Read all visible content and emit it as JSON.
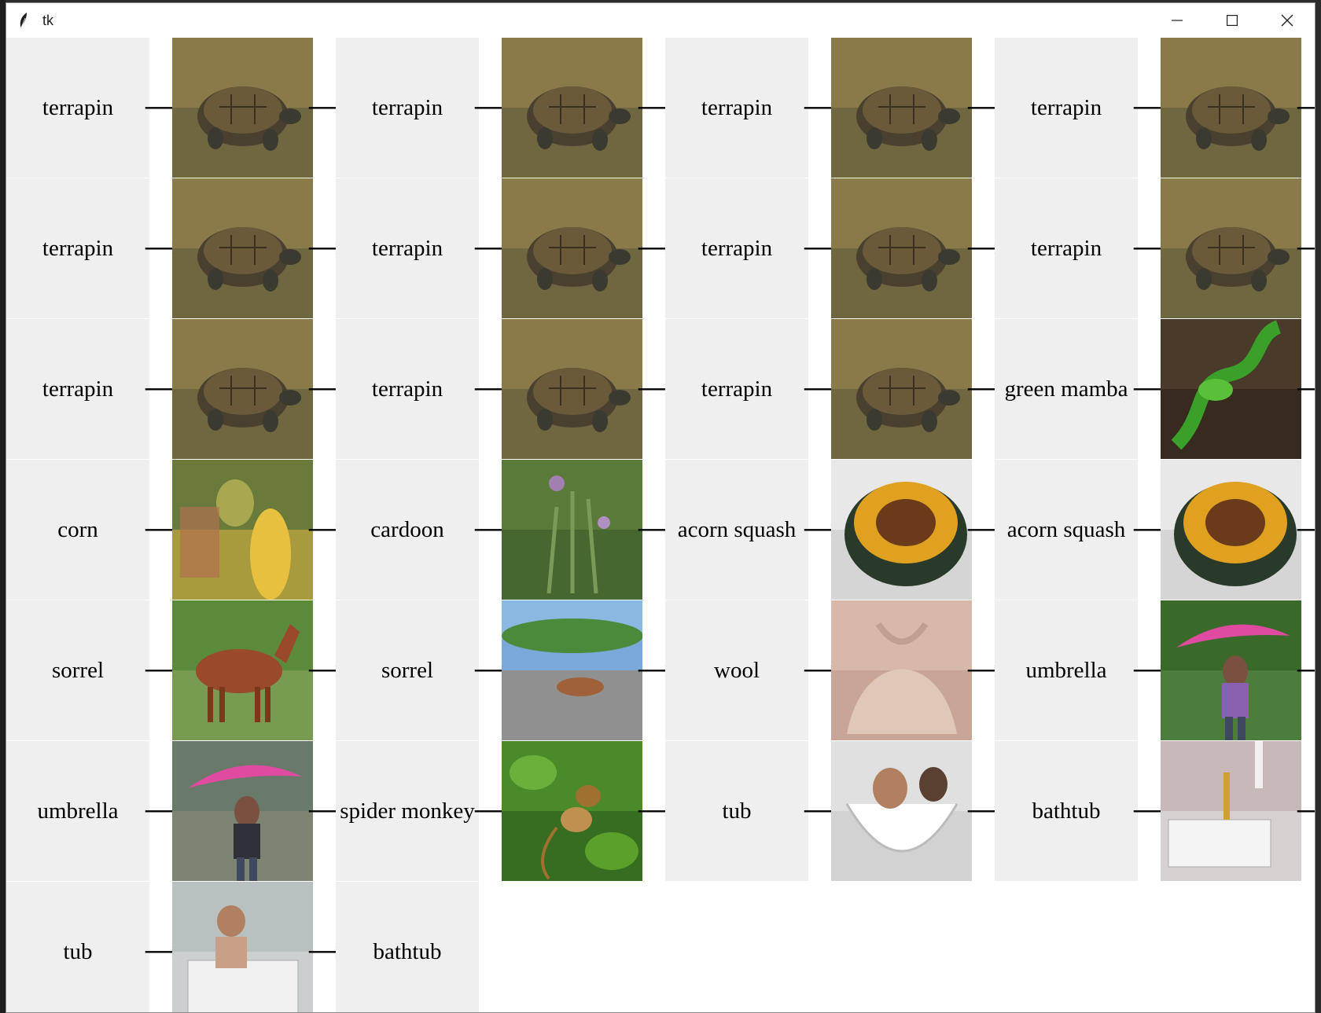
{
  "window": {
    "title": "tk",
    "controls": [
      "minimize",
      "maximize",
      "close"
    ]
  },
  "grid": {
    "arrow": "⟶",
    "rows": [
      [
        {
          "label": "terrapin",
          "image": "terrapin"
        },
        {
          "label": "terrapin",
          "image": "terrapin"
        },
        {
          "label": "terrapin",
          "image": "terrapin"
        },
        {
          "label": "terrapin",
          "image": "terrapin"
        }
      ],
      [
        {
          "label": "terrapin",
          "image": "terrapin"
        },
        {
          "label": "terrapin",
          "image": "terrapin"
        },
        {
          "label": "terrapin",
          "image": "terrapin"
        },
        {
          "label": "terrapin",
          "image": "terrapin"
        }
      ],
      [
        {
          "label": "terrapin",
          "image": "terrapin"
        },
        {
          "label": "terrapin",
          "image": "terrapin"
        },
        {
          "label": "terrapin",
          "image": "terrapin"
        },
        {
          "label": "green mamba",
          "image": "green-mamba"
        }
      ],
      [
        {
          "label": "corn",
          "image": "corn"
        },
        {
          "label": "cardoon",
          "image": "cardoon"
        },
        {
          "label": "acorn squash",
          "image": "acorn-squash"
        },
        {
          "label": "acorn squash",
          "image": "acorn-squash"
        }
      ],
      [
        {
          "label": "sorrel",
          "image": "sorrel"
        },
        {
          "label": "sorrel",
          "image": "sorrel-field"
        },
        {
          "label": "wool",
          "image": "wool"
        },
        {
          "label": "umbrella",
          "image": "umbrella"
        }
      ],
      [
        {
          "label": "umbrella",
          "image": "umbrella-person"
        },
        {
          "label": "spider monkey",
          "image": "spider-monkey"
        },
        {
          "label": "tub",
          "image": "tub"
        },
        {
          "label": "bathtub",
          "image": "bathtub"
        }
      ],
      [
        {
          "label": "tub",
          "image": "tub-person"
        },
        {
          "label": "bathtub",
          "image": ""
        }
      ]
    ]
  },
  "colors": {
    "label_bg": "#efefef",
    "window_bg": "#ffffff"
  }
}
